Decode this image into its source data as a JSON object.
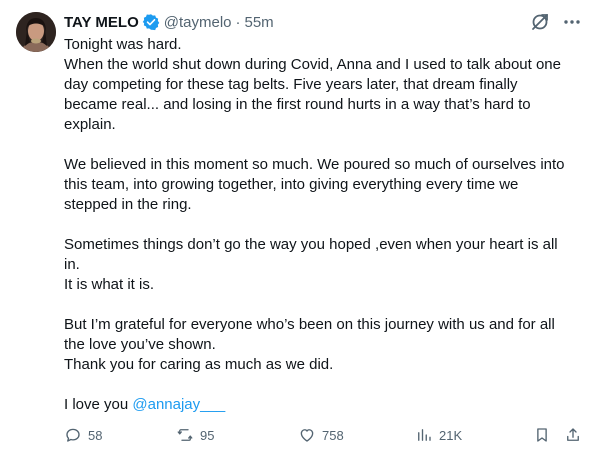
{
  "author": {
    "name": "TAY MELO",
    "handle": "@taymelo",
    "separator": "·",
    "time": "55m"
  },
  "tweet": {
    "lines_p1": [
      "Tonight was hard.",
      "When the world shut down during Covid, Anna and I used to talk about one",
      "day competing for these tag belts. Five years later, that dream finally",
      "became real... and losing in the first round hurts in a way that’s hard to",
      "explain."
    ],
    "lines_p2": [
      "We believed in this moment so much. We poured so much of ourselves into",
      "this team, into growing together, into giving everything every time we",
      "stepped in the ring."
    ],
    "lines_p3": [
      "Sometimes things don’t go the way you hoped ,even when your heart is all",
      "in.",
      "It is what it is."
    ],
    "lines_p4": [
      "But I’m grateful for everyone who’s been on this journey with us and for all",
      "the love you’ve shown.",
      "Thank you for caring as much as we did."
    ],
    "closing_text": "I love you ",
    "mention": "@annajay___"
  },
  "stats": {
    "replies": "58",
    "reposts": "95",
    "likes": "758",
    "views": "21K"
  },
  "colors": {
    "text": "#0f1419",
    "secondary": "#536471",
    "accent": "#1d9bf0"
  }
}
